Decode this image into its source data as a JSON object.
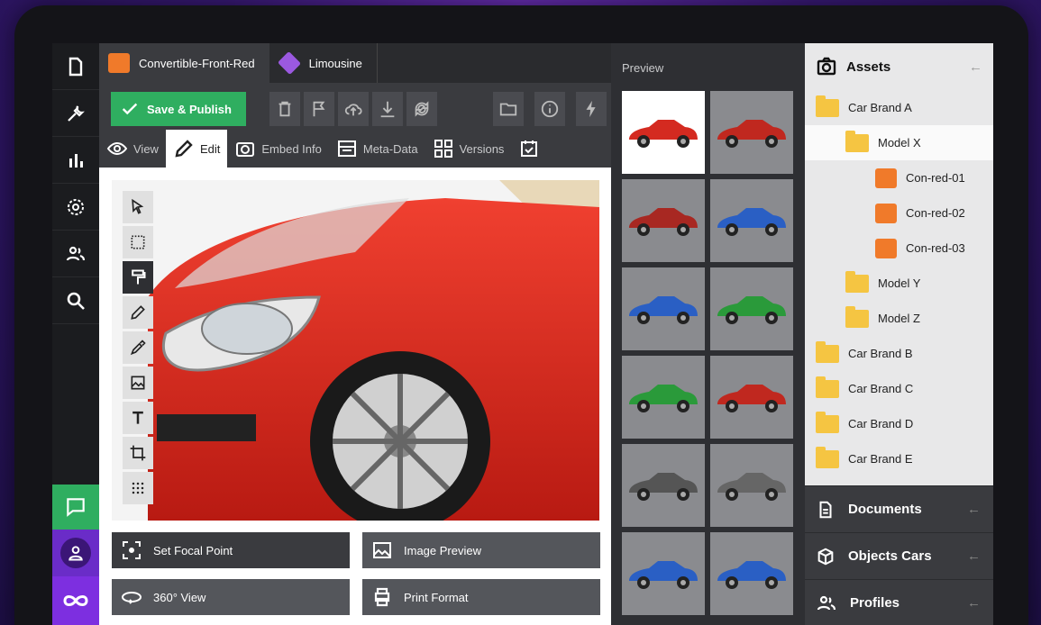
{
  "rail": {
    "icons": [
      "file-icon",
      "wrench-icon",
      "bar-chart-icon",
      "gear-icon",
      "users-icon",
      "search-icon"
    ],
    "bottom_icons": [
      "chat-icon",
      "user-icon",
      "infinity-icon"
    ]
  },
  "tabs": [
    {
      "label": "Convertible-Front-Red",
      "icon": "image-icon",
      "color": "#f07a2a"
    },
    {
      "label": "Limousine",
      "icon": "cube-icon",
      "color": "#9b59e0"
    }
  ],
  "toolbar": {
    "save_label": "Save & Publish",
    "icons": [
      "trash-icon",
      "flag-icon",
      "upload-cloud-icon",
      "download-icon",
      "refresh-icon",
      "folder-icon",
      "info-icon",
      "bolt-icon"
    ]
  },
  "subtabs": [
    {
      "label": "View",
      "icon": "eye-icon"
    },
    {
      "label": "Edit",
      "icon": "pencil-icon"
    },
    {
      "label": "Embed Info",
      "icon": "camera-icon"
    },
    {
      "label": "Meta-Data",
      "icon": "form-icon"
    },
    {
      "label": "Versions",
      "icon": "grid-icon"
    }
  ],
  "tools": [
    "cursor-icon",
    "select-area-icon",
    "paint-roller-icon",
    "pencil-icon",
    "eyedropper-icon",
    "image-icon",
    "text-icon",
    "crop-icon",
    "dots-icon"
  ],
  "actions": {
    "focal": "Set Focal Point",
    "preview": "Image Preview",
    "view360": "360° View",
    "print": "Print Format"
  },
  "preview": {
    "title": "Preview",
    "thumbs": [
      {
        "color": "#d42a20",
        "selected": true
      },
      {
        "color": "#c0281f"
      },
      {
        "color": "#a82822"
      },
      {
        "color": "#2a5fc4"
      },
      {
        "color": "#2a5fc4"
      },
      {
        "color": "#2a9a3a"
      },
      {
        "color": "#2a9a3a"
      },
      {
        "color": "#c0281f"
      },
      {
        "color": "#555"
      },
      {
        "color": "#666"
      },
      {
        "color": "#2a5fc4"
      },
      {
        "color": "#2a5fc4"
      }
    ]
  },
  "assets": {
    "title": "Assets",
    "tree": [
      {
        "label": "Car Brand A",
        "type": "folder",
        "level": 0
      },
      {
        "label": "Model X",
        "type": "folder",
        "level": 1,
        "highlight": true
      },
      {
        "label": "Con-red-01",
        "type": "image",
        "level": 2
      },
      {
        "label": "Con-red-02",
        "type": "image",
        "level": 2
      },
      {
        "label": "Con-red-03",
        "type": "image",
        "level": 2
      },
      {
        "label": "Model Y",
        "type": "folder",
        "level": 1
      },
      {
        "label": "Model Z",
        "type": "folder",
        "level": 1
      },
      {
        "label": "Car Brand B",
        "type": "folder",
        "level": 0
      },
      {
        "label": "Car Brand C",
        "type": "folder",
        "level": 0
      },
      {
        "label": "Car Brand D",
        "type": "folder",
        "level": 0
      },
      {
        "label": "Car Brand E",
        "type": "folder",
        "level": 0
      }
    ],
    "sections": [
      {
        "label": "Documents",
        "icon": "document-icon"
      },
      {
        "label": "Objects Cars",
        "icon": "cube-icon"
      },
      {
        "label": "Profiles",
        "icon": "users-icon"
      }
    ],
    "arrow": "←"
  },
  "colors": {
    "accent_green": "#2fae60",
    "accent_purple": "#7d2fe0",
    "car_red": "#d42a20"
  }
}
